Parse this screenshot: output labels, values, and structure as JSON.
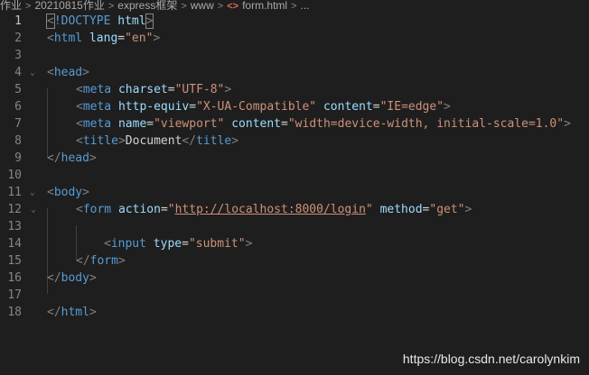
{
  "breadcrumb": {
    "items": [
      "作业",
      "20210815作业",
      "express框架",
      "www",
      "form.html",
      "..."
    ],
    "file_icon": "html-file-icon"
  },
  "lines": [
    {
      "n": "1"
    },
    {
      "n": "2"
    },
    {
      "n": "3"
    },
    {
      "n": "4"
    },
    {
      "n": "5"
    },
    {
      "n": "6"
    },
    {
      "n": "7"
    },
    {
      "n": "8"
    },
    {
      "n": "9"
    },
    {
      "n": "10"
    },
    {
      "n": "11"
    },
    {
      "n": "12"
    },
    {
      "n": "13"
    },
    {
      "n": "14"
    },
    {
      "n": "15"
    },
    {
      "n": "16"
    },
    {
      "n": "17"
    },
    {
      "n": "18"
    }
  ],
  "code": {
    "l1": {
      "doctype": "!DOCTYPE",
      "html": "html"
    },
    "l2": {
      "tag": "html",
      "attr": "lang",
      "val": "\"en\""
    },
    "l4": {
      "tag": "head"
    },
    "l5": {
      "tag": "meta",
      "attr": "charset",
      "val": "\"UTF-8\""
    },
    "l6": {
      "tag": "meta",
      "attr1": "http-equiv",
      "val1": "\"X-UA-Compatible\"",
      "attr2": "content",
      "val2": "\"IE=edge\""
    },
    "l7": {
      "tag": "meta",
      "attr1": "name",
      "val1": "\"viewport\"",
      "attr2": "content",
      "val2": "\"width=device-width, initial-scale=1.0\""
    },
    "l8": {
      "tag": "title",
      "text": "Document"
    },
    "l9": {
      "tag": "head"
    },
    "l11": {
      "tag": "body"
    },
    "l12": {
      "tag": "form",
      "attr1": "action",
      "val_q": "\"",
      "url": "http://localhost:8000/login",
      "attr2": "method",
      "val2": "\"get\""
    },
    "l14": {
      "tag": "input",
      "attr": "type",
      "val": "\"submit\""
    },
    "l15": {
      "tag": "form"
    },
    "l16": {
      "tag": "body"
    },
    "l18": {
      "tag": "html"
    }
  },
  "watermark": "https://blog.csdn.net/carolynkim"
}
